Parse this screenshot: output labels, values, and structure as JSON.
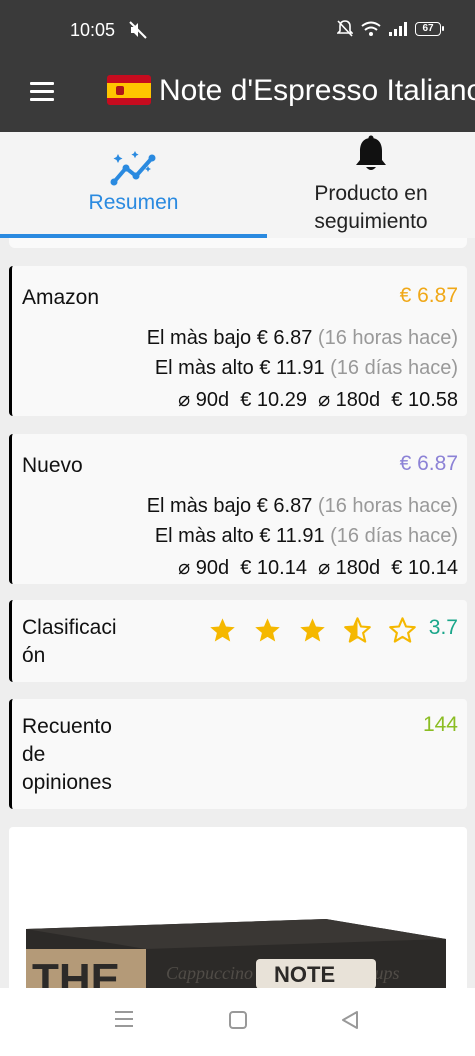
{
  "status_bar": {
    "time": "10:05",
    "battery": "67"
  },
  "app_bar": {
    "title": "Note d'Espresso Italiano"
  },
  "tabs": [
    {
      "label": "Resumen"
    },
    {
      "label_line1": "Producto en",
      "label_line2": "seguimiento"
    }
  ],
  "amazon": {
    "title": "Amazon",
    "price": "€ 6.87",
    "accent": "#f0a818",
    "lowest_label": "El màs bajo",
    "lowest_value": "€ 6.87",
    "lowest_when": "(16 horas hace)",
    "highest_label": "El màs alto",
    "highest_value": "€ 11.91",
    "highest_when": "(16 días hace)",
    "avg": "⌀ 90d  € 10.29  ⌀ 180d  € 10.58"
  },
  "nuevo": {
    "title": "Nuevo",
    "price": "€ 6.87",
    "accent": "#8c82d6",
    "lowest_label": "El màs bajo",
    "lowest_value": "€ 6.87",
    "lowest_when": "(16 horas hace)",
    "highest_label": "El màs alto",
    "highest_value": "€ 11.91",
    "highest_when": "(16 días hace)",
    "avg": "⌀ 90d  € 10.14  ⌀ 180d  € 10.14"
  },
  "rating": {
    "title_line1": "Clasificaci",
    "title_line2": "ón",
    "value": "3.7",
    "stars_filled": 3.5,
    "accent": "#1aa68a"
  },
  "reviews": {
    "title_line1": "Recuento",
    "title_line2": "de",
    "title_line3": "opiniones",
    "value": "144",
    "accent": "#8bbd23"
  },
  "product_image": {
    "brand_text": "NOTE"
  }
}
